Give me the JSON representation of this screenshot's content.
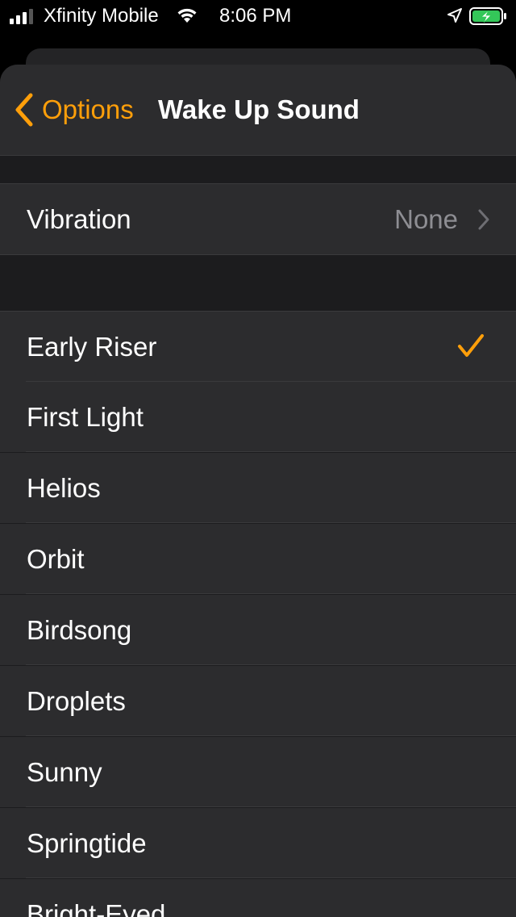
{
  "status_bar": {
    "carrier": "Xfinity Mobile",
    "time": "8:06 PM",
    "signal_icon": "cellular-signal-icon",
    "wifi_icon": "wifi-icon",
    "location_icon": "location-arrow-icon",
    "battery_icon": "battery-charging-icon",
    "battery_color": "#34c759"
  },
  "navbar": {
    "back_label": "Options",
    "title": "Wake Up Sound",
    "accent_color": "#ff9f0a"
  },
  "vibration": {
    "label": "Vibration",
    "value": "None"
  },
  "sounds": {
    "selected": "Early Riser",
    "items": [
      {
        "label": "Early Riser"
      },
      {
        "label": "First Light"
      },
      {
        "label": "Helios"
      },
      {
        "label": "Orbit"
      },
      {
        "label": "Birdsong"
      },
      {
        "label": "Droplets"
      },
      {
        "label": "Sunny"
      },
      {
        "label": "Springtide"
      },
      {
        "label": "Bright-Eyed"
      }
    ]
  }
}
